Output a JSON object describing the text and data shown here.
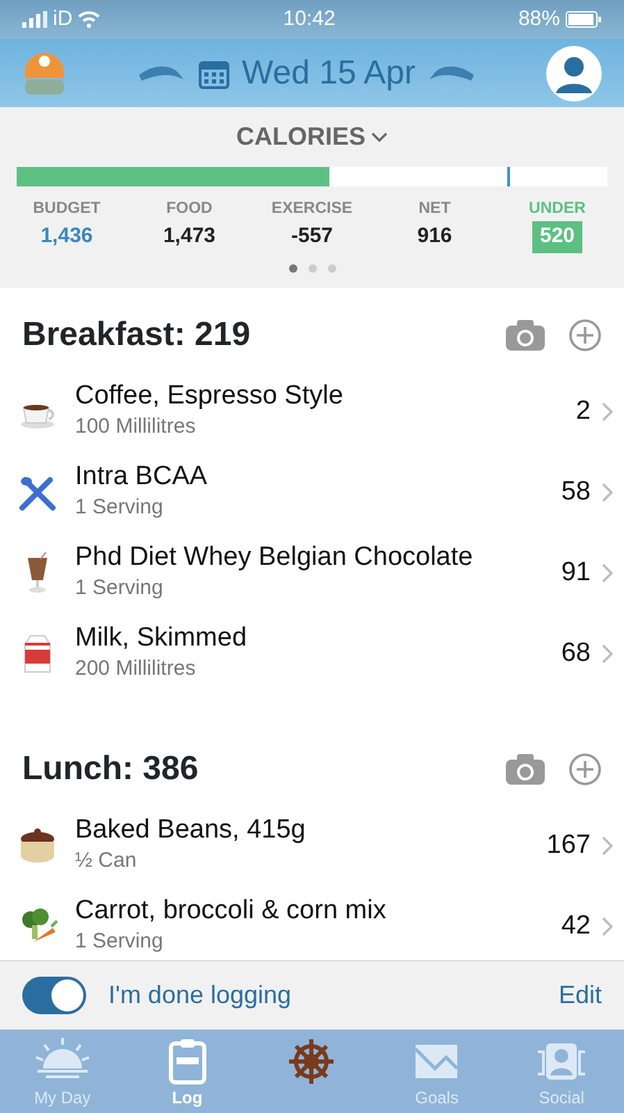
{
  "status_bar": {
    "carrier": "iD",
    "time": "10:42",
    "battery": "88%"
  },
  "header": {
    "date": "Wed 15 Apr"
  },
  "summary": {
    "title": "CALORIES",
    "level": 0.53,
    "goal_marker": {
      "level": 0.83
    },
    "figures": [
      {
        "label": "BUDGET",
        "value": "1,436",
        "kind": "budget"
      },
      {
        "label": "FOOD",
        "value": "1,473",
        "kind": "plain"
      },
      {
        "label": "EXERCISE",
        "value": "-557",
        "kind": "plain"
      },
      {
        "label": "NET",
        "value": "916",
        "kind": "plain"
      },
      {
        "label": "UNDER",
        "value": "520",
        "kind": "under"
      }
    ],
    "pages": [
      {
        "selected": true
      },
      {
        "selected": false
      },
      {
        "selected": false
      }
    ]
  },
  "meals": [
    {
      "title": "Breakfast: 219",
      "items": [
        {
          "name": "Coffee, Espresso Style",
          "amount": "100 Millilitres",
          "calories": "2",
          "kind": "cup"
        },
        {
          "name": "Intra BCAA",
          "amount": "1 Serving",
          "calories": "58",
          "kind": "cutlery"
        },
        {
          "name": "Phd Diet Whey Belgian Chocolate",
          "amount": "1 Serving",
          "calories": "91",
          "kind": "shake"
        },
        {
          "name": "Milk, Skimmed",
          "amount": "200 Millilitres",
          "calories": "68",
          "kind": "carton"
        }
      ]
    },
    {
      "title": "Lunch: 386",
      "items": [
        {
          "name": "Baked Beans, 415g",
          "amount": "½ Can",
          "calories": "167",
          "kind": "pot"
        },
        {
          "name": "Carrot, broccoli & corn mix",
          "amount": "1 Serving",
          "calories": "42",
          "kind": "veg"
        }
      ]
    }
  ],
  "done_bar": {
    "label": "I'm done logging",
    "on": true,
    "edit": "Edit"
  },
  "tabs": [
    {
      "label": "My Day",
      "kind": "sun",
      "selected": false
    },
    {
      "label": "Log",
      "kind": "clipboard",
      "selected": true
    },
    {
      "kind": "wheel",
      "selected": false
    },
    {
      "label": "Goals",
      "kind": "envelope",
      "selected": false
    },
    {
      "label": "Social",
      "kind": "people",
      "selected": false
    }
  ]
}
